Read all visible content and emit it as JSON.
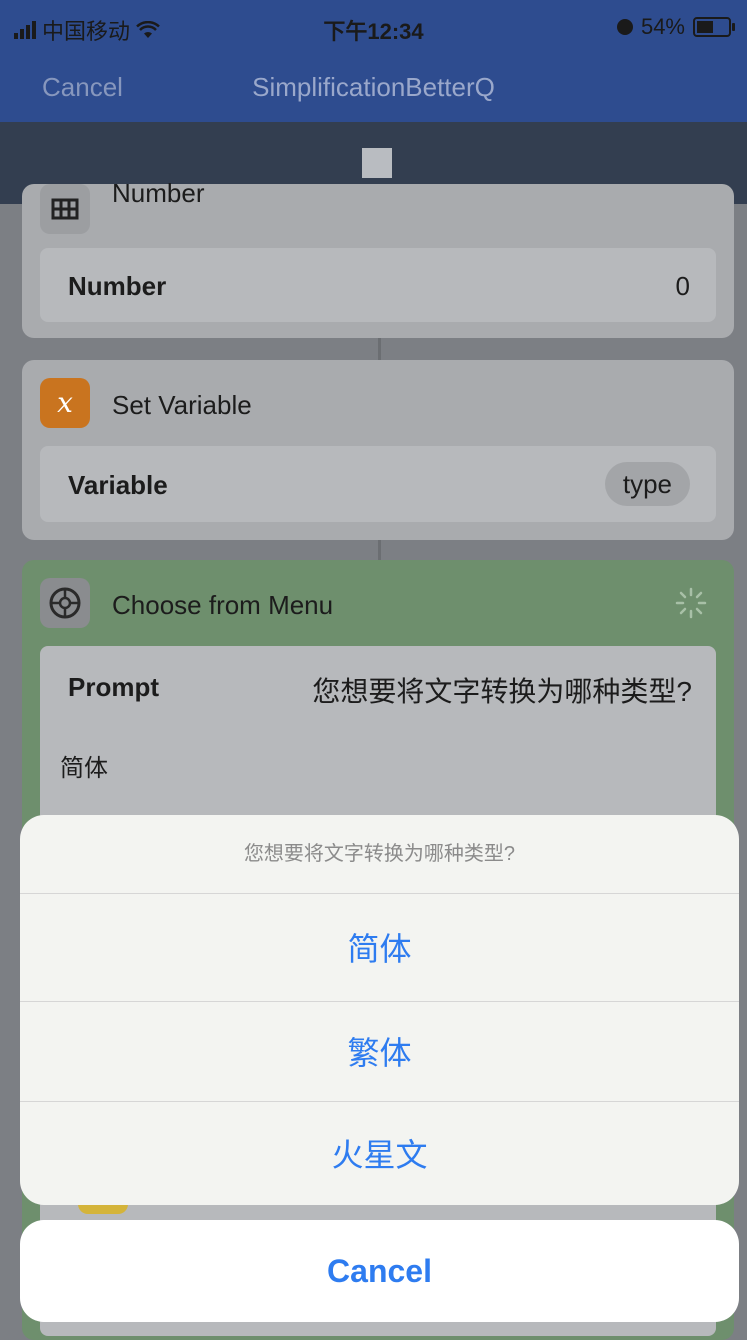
{
  "status_bar": {
    "carrier": "中国移动",
    "time": "下午12:34",
    "battery": "54%",
    "battery_level": 0.54
  },
  "nav": {
    "cancel_label": "Cancel",
    "title": "SimplificationBetterQ"
  },
  "actions": {
    "number": {
      "title": "Number",
      "field_label": "Number",
      "field_value": "0"
    },
    "set_variable": {
      "title": "Set Variable",
      "field_label": "Variable",
      "field_value": "type",
      "icon_glyph": "x"
    },
    "choose_menu": {
      "title": "Choose from Menu",
      "prompt_label": "Prompt",
      "prompt_value": "您想要将文字转换为哪种类型?",
      "first_item": "简体"
    }
  },
  "action_sheet": {
    "prompt": "您想要将文字转换为哪种类型?",
    "options": [
      "简体",
      "繁体",
      "火星文"
    ],
    "cancel_label": "Cancel"
  },
  "colors": {
    "nav_blue": "#2e4c8f",
    "accent": "#2e7cf0",
    "menu_green": "#6e8f6d",
    "variable_orange": "#c9741f"
  },
  "icons": [
    "signal-icon",
    "wifi-icon",
    "alarm-icon",
    "battery-icon",
    "stop-icon",
    "number-icon",
    "variable-icon",
    "gear-icon",
    "spinner-icon"
  ]
}
